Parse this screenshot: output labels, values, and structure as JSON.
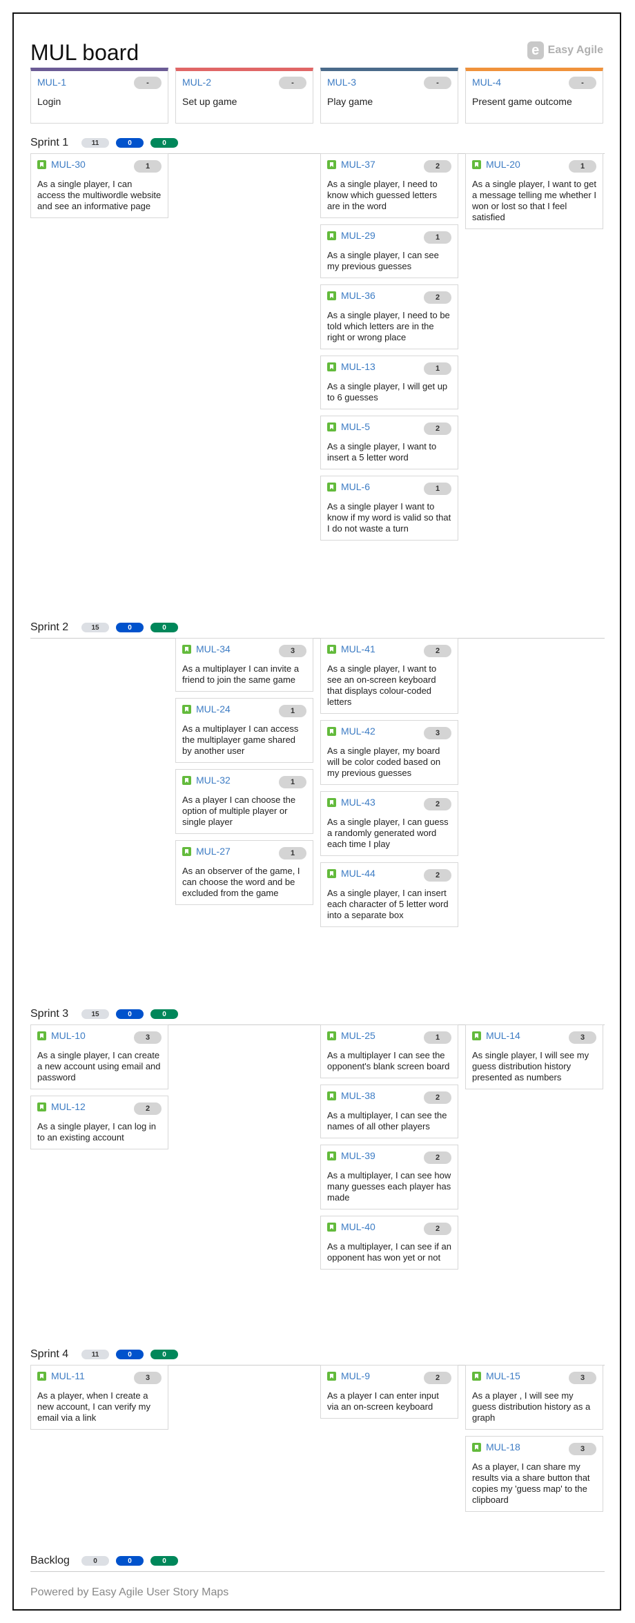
{
  "board": {
    "title": "MUL board",
    "logo_text": "Easy Agile",
    "logo_mark": "e",
    "footer": "Powered by Easy Agile User Story Maps"
  },
  "epics": [
    {
      "key": "MUL-1",
      "name": "Login",
      "points": "-",
      "color": "#6b5b95"
    },
    {
      "key": "MUL-2",
      "name": "Set up game",
      "points": "-",
      "color": "#e06666"
    },
    {
      "key": "MUL-3",
      "name": "Play game",
      "points": "-",
      "color": "#4a6a8a"
    },
    {
      "key": "MUL-4",
      "name": "Present game outcome",
      "points": "-",
      "color": "#f0923b"
    }
  ],
  "sprints": [
    {
      "name": "Sprint 1",
      "total": "11",
      "in_progress": "0",
      "done": "0",
      "columns": [
        [
          {
            "key": "MUL-30",
            "points": "1",
            "summary": "As a single player, I can access the multiwordle website and see an informative page"
          }
        ],
        [],
        [
          {
            "key": "MUL-37",
            "points": "2",
            "summary": "As a single player, I need to know which guessed letters are in the word"
          },
          {
            "key": "MUL-29",
            "points": "1",
            "summary": "As a single player, I can see my previous guesses"
          },
          {
            "key": "MUL-36",
            "points": "2",
            "summary": "As a single player, I need to be told which letters are in the right or wrong place"
          },
          {
            "key": "MUL-13",
            "points": "1",
            "summary": "As a single player, I will get up to 6 guesses"
          },
          {
            "key": "MUL-5",
            "points": "2",
            "summary": "As a single player, I want to insert a 5 letter word"
          },
          {
            "key": "MUL-6",
            "points": "1",
            "summary": "As a single player I want to know if my word is valid so that I do not waste a turn"
          }
        ],
        [
          {
            "key": "MUL-20",
            "points": "1",
            "summary": "As a single player, I want to get a message telling me whether I won or lost so that I feel satisfied"
          }
        ]
      ]
    },
    {
      "name": "Sprint 2",
      "total": "15",
      "in_progress": "0",
      "done": "0",
      "columns": [
        [],
        [
          {
            "key": "MUL-34",
            "points": "3",
            "summary": "As a multiplayer I can invite a friend to join the same game"
          },
          {
            "key": "MUL-24",
            "points": "1",
            "summary": "As a multiplayer I can access the multiplayer game shared by another user"
          },
          {
            "key": "MUL-32",
            "points": "1",
            "summary": "As a player I can choose the option of multiple player or single player"
          },
          {
            "key": "MUL-27",
            "points": "1",
            "summary": "As an observer of the game, I can choose the word and be excluded from the game"
          }
        ],
        [
          {
            "key": "MUL-41",
            "points": "2",
            "summary": "As a single player, I want to see an on-screen keyboard that displays colour-coded letters"
          },
          {
            "key": "MUL-42",
            "points": "3",
            "summary": "As a single player, my board will be color coded based on my previous guesses"
          },
          {
            "key": "MUL-43",
            "points": "2",
            "summary": "As a single player, I can guess a randomly generated word each time I play"
          },
          {
            "key": "MUL-44",
            "points": "2",
            "summary": "As a single player, I can insert each character of 5 letter word into a separate box"
          }
        ],
        []
      ]
    },
    {
      "name": "Sprint 3",
      "total": "15",
      "in_progress": "0",
      "done": "0",
      "columns": [
        [
          {
            "key": "MUL-10",
            "points": "3",
            "summary": "As a single player, I can create a new account using email and password"
          },
          {
            "key": "MUL-12",
            "points": "2",
            "summary": "As a single player, I can log in to an existing account"
          }
        ],
        [],
        [
          {
            "key": "MUL-25",
            "points": "1",
            "summary": "As a multiplayer I can see the opponent's blank screen board"
          },
          {
            "key": "MUL-38",
            "points": "2",
            "summary": "As a multiplayer, I can see the names of all other players"
          },
          {
            "key": "MUL-39",
            "points": "2",
            "summary": "As a multiplayer, I can see how many guesses each player has made"
          },
          {
            "key": "MUL-40",
            "points": "2",
            "summary": "As a multiplayer, I can see if an opponent has won yet or not"
          }
        ],
        [
          {
            "key": "MUL-14",
            "points": "3",
            "summary": "As single player, I will see my guess distribution history presented as numbers"
          }
        ]
      ]
    },
    {
      "name": "Sprint 4",
      "total": "11",
      "in_progress": "0",
      "done": "0",
      "columns": [
        [
          {
            "key": "MUL-11",
            "points": "3",
            "summary": "As a player, when I create a new account, I can verify my email via a link"
          }
        ],
        [],
        [
          {
            "key": "MUL-9",
            "points": "2",
            "summary": "As a player I can enter input via an on-screen keyboard"
          }
        ],
        [
          {
            "key": "MUL-15",
            "points": "3",
            "summary": "As a player , I will see my guess distribution history as a graph"
          },
          {
            "key": "MUL-18",
            "points": "3",
            "summary": "As a player, I can share my results via a share button that copies my 'guess map' to the clipboard"
          }
        ]
      ]
    },
    {
      "name": "Backlog",
      "total": "0",
      "in_progress": "0",
      "done": "0",
      "columns": [
        [],
        [],
        [],
        []
      ]
    }
  ]
}
